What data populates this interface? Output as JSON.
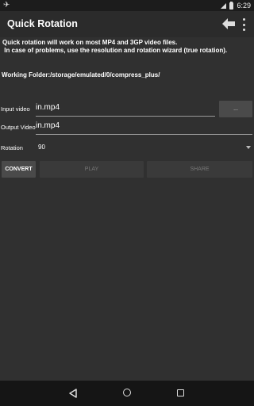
{
  "status_bar": {
    "time": "6:29"
  },
  "action_bar": {
    "title": "Quick Rotation"
  },
  "info_text": "Quick rotation will work on most MP4 and 3GP video files.\n In case of problems, use the resolution and rotation wizard (true rotation).",
  "working_folder": "Working Folder:/storage/emulated/0/compress_plus/",
  "input_video": {
    "label": "Input video",
    "value": "in.mp4",
    "browse_label": "..."
  },
  "output_video": {
    "label": "Output Video",
    "value": "in.mp4"
  },
  "rotation": {
    "label": "Rotation",
    "value": "90"
  },
  "buttons": {
    "convert": "CONVERT",
    "play": "PLAY",
    "share": "SHARE"
  },
  "icons": {
    "status": [
      "airplane-mode-icon",
      "signal-icon",
      "battery-icon"
    ],
    "action": [
      "back-arrow-icon",
      "overflow-menu-icon"
    ],
    "nav": [
      "nav-back-icon",
      "nav-home-icon",
      "nav-recents-icon"
    ]
  }
}
